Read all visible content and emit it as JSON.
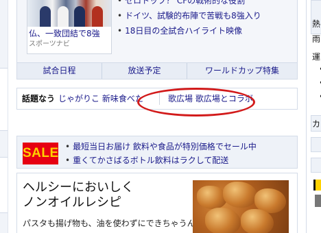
{
  "news": {
    "caption_title": "仏、一致団結で8強",
    "caption_source": "スポーツナビ",
    "headlines": [
      "ゼロトップ？ CFの戦術的な役割",
      "ドイツ、試験的布陣で苦戦も8強入り",
      "18日目の全試合ハイライト映像"
    ]
  },
  "worldcup_tabs": [
    "試合日程",
    "放送予定",
    "ワールドカップ特集"
  ],
  "trending": {
    "label": "話題なう",
    "items": [
      "じゃがりこ 新味食べた",
      "歌広場 歌広場とコラボ"
    ]
  },
  "highlight_color": "#d21a1a",
  "sale": {
    "badge": "SALE",
    "badge_bg": "#e60012",
    "badge_fg": "#ffd200",
    "items": [
      "最短当日お届け 飲料や食品が特別価格でセール中",
      "重くてかさばるボトル飲料はラクして配送"
    ]
  },
  "recipe": {
    "title_line1": "ヘルシーにおいしく",
    "title_line2": "ノンオイルレシピ",
    "subtitle": "パスタも揚げ物も、油を使わずにできちゃうん"
  },
  "right_column": {
    "labels": [
      "熱",
      "雨",
      "運",
      "カ"
    ]
  }
}
